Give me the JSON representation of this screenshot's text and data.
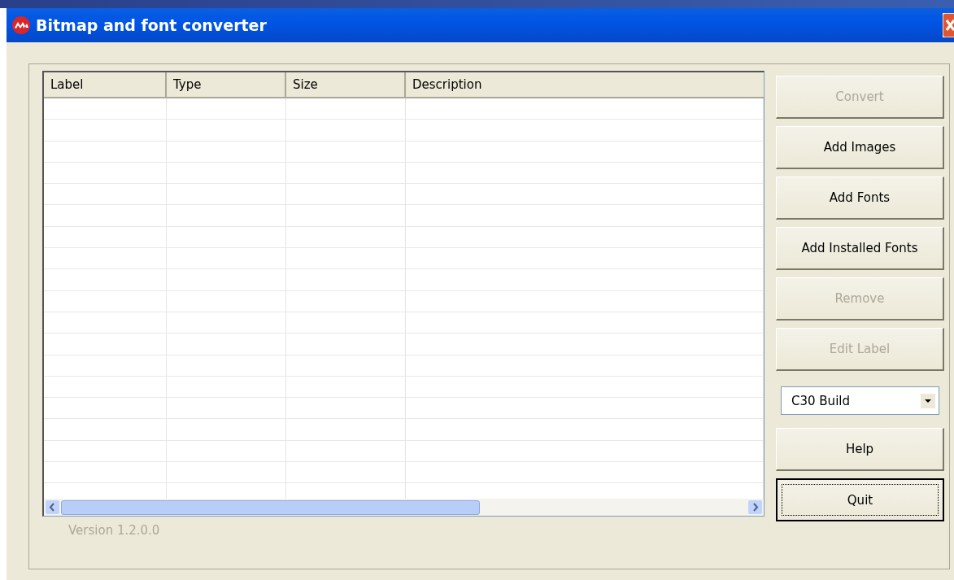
{
  "window": {
    "title": "Bitmap and font converter"
  },
  "table": {
    "columns": [
      "Label",
      "Type",
      "Size",
      "Description"
    ]
  },
  "buttons": [
    {
      "label": "Convert",
      "disabled": true,
      "focused": false
    },
    {
      "label": "Add Images",
      "disabled": false,
      "focused": false
    },
    {
      "label": "Add Fonts",
      "disabled": false,
      "focused": false
    },
    {
      "label": "Add Installed Fonts",
      "disabled": false,
      "focused": false
    },
    {
      "label": "Remove",
      "disabled": true,
      "focused": false
    },
    {
      "label": "Edit Label",
      "disabled": true,
      "focused": false
    }
  ],
  "build_select": {
    "value": "C30 Build"
  },
  "bottom_buttons": [
    {
      "label": "Help",
      "disabled": false,
      "focused": false
    },
    {
      "label": "Quit",
      "disabled": false,
      "focused": true
    }
  ],
  "version": "Version 1.2.0.0"
}
